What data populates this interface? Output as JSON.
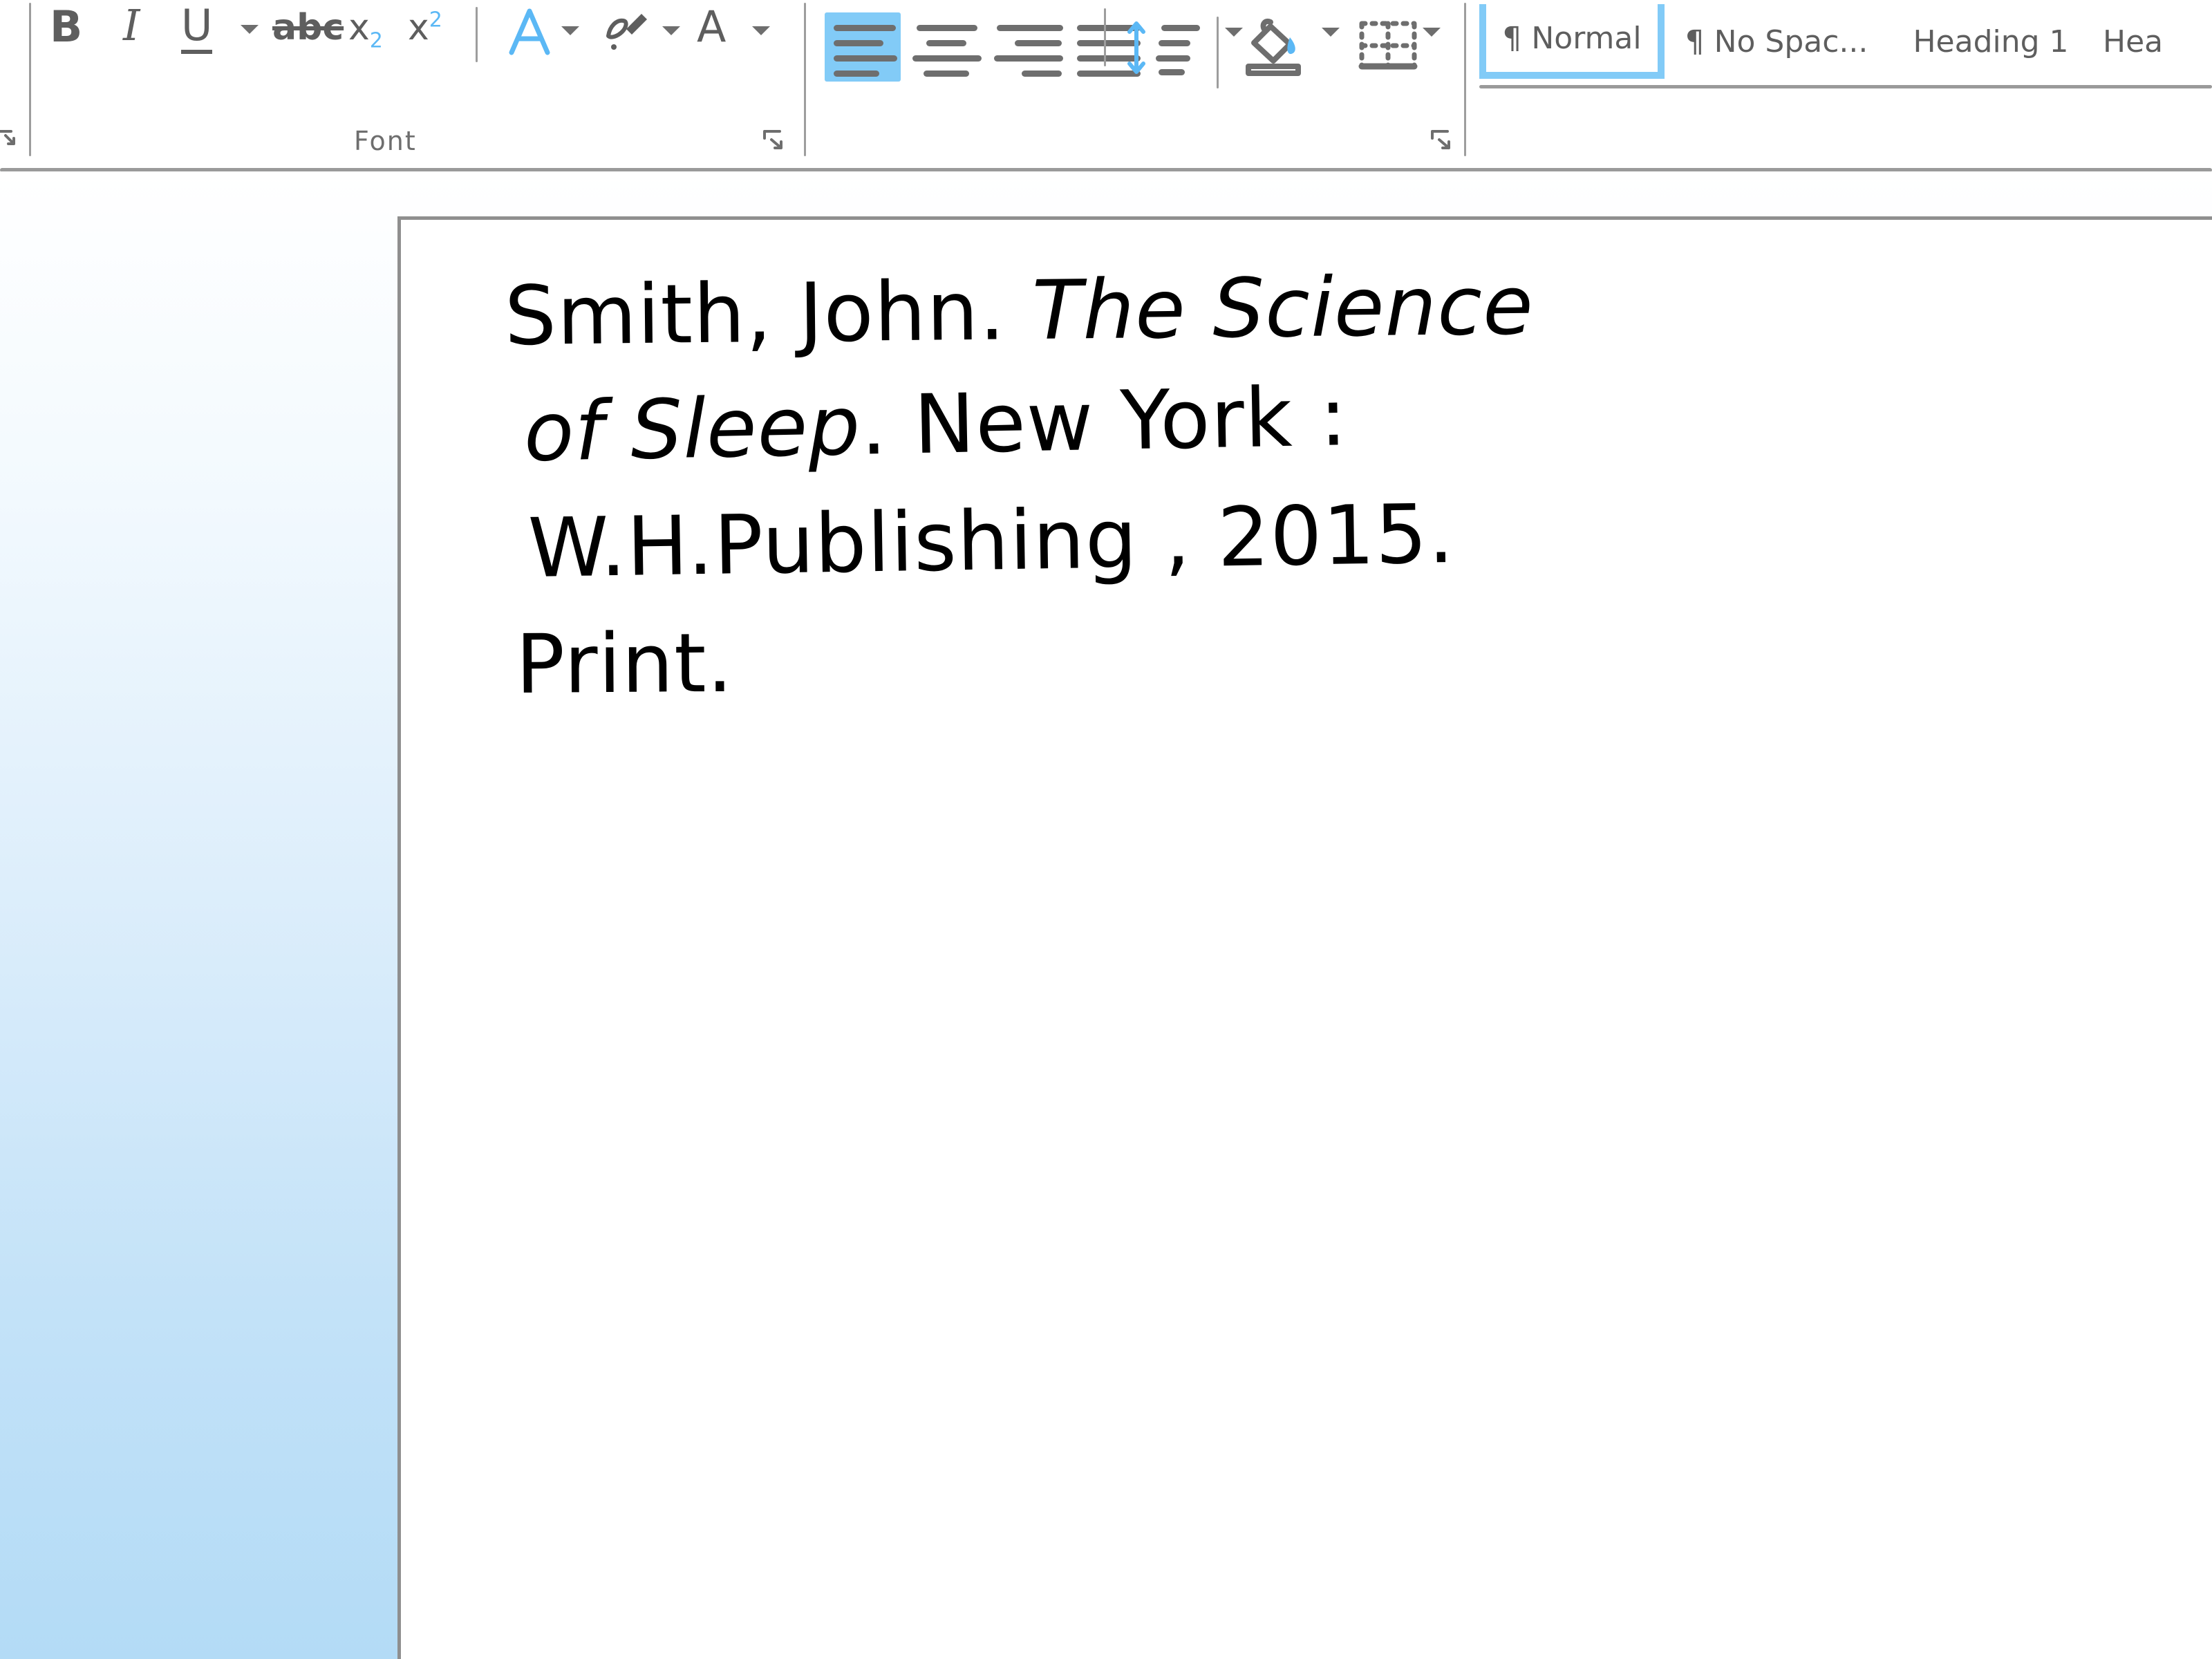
{
  "app": {
    "accent_blue": "#5bb8f5",
    "selection_blue": "#82cbf7",
    "icon_gray": "#5e5e5e",
    "page_background": "#ffffff"
  },
  "ribbon": {
    "groups": [
      {
        "name": "font",
        "label": "Font",
        "dialog_launcher": "dialog-launcher-icon",
        "items": [
          {
            "name": "bold",
            "glyph": "B"
          },
          {
            "name": "italic",
            "glyph": "I"
          },
          {
            "name": "underline",
            "glyph": "U"
          },
          {
            "name": "underline-dropdown",
            "glyph": "chevron-down-icon"
          },
          {
            "name": "strikethrough",
            "glyph": "abc"
          },
          {
            "name": "subscript",
            "glyph": "x",
            "script": "2"
          },
          {
            "name": "superscript",
            "glyph": "x",
            "script": "2"
          },
          {
            "name": "text-effects",
            "glyph": "A"
          },
          {
            "name": "text-effects-dropdown",
            "glyph": "chevron-down-icon"
          },
          {
            "name": "text-highlight-color",
            "glyph": "highlighter-icon"
          },
          {
            "name": "text-highlight-dropdown",
            "glyph": "chevron-down-icon"
          },
          {
            "name": "font-color",
            "glyph": "A"
          },
          {
            "name": "font-color-dropdown",
            "glyph": "chevron-down-icon"
          }
        ]
      },
      {
        "name": "paragraph",
        "label": "",
        "dialog_launcher": "dialog-launcher-icon",
        "items": [
          {
            "name": "align-left",
            "selected": true
          },
          {
            "name": "align-center",
            "selected": false
          },
          {
            "name": "align-right",
            "selected": false
          },
          {
            "name": "justify",
            "selected": false
          },
          {
            "name": "line-and-paragraph-spacing",
            "selected": false
          },
          {
            "name": "line-spacing-dropdown",
            "glyph": "chevron-down-icon"
          },
          {
            "name": "shading",
            "glyph": "paint-bucket-icon"
          },
          {
            "name": "shading-dropdown",
            "glyph": "chevron-down-icon"
          },
          {
            "name": "borders",
            "glyph": "borders-icon"
          },
          {
            "name": "borders-dropdown",
            "glyph": "chevron-down-icon"
          }
        ]
      }
    ],
    "styles_gallery": {
      "name": "styles",
      "items": [
        {
          "label": "¶ Normal",
          "selected": true
        },
        {
          "label": "¶ No Spac...",
          "selected": false
        },
        {
          "label": "Heading 1",
          "selected": false
        },
        {
          "label": "Hea",
          "selected": false,
          "clipped": true
        }
      ]
    }
  },
  "document": {
    "lines": [
      {
        "segments": [
          {
            "text": "Smith, John. ",
            "style": "normal"
          },
          {
            "text": "The Science",
            "style": "italic"
          }
        ]
      },
      {
        "segments": [
          {
            "text": "of Sleep",
            "style": "italic"
          },
          {
            "text": ". New York :",
            "style": "normal"
          }
        ]
      },
      {
        "segments": [
          {
            "text": "W.H.Publishing , 2015.",
            "style": "normal"
          }
        ]
      },
      {
        "segments": [
          {
            "text": "Print.",
            "style": "normal"
          }
        ]
      }
    ],
    "plain_text": "Smith, John. The Science of Sleep. New York: W.H.Publishing, 2015. Print."
  }
}
